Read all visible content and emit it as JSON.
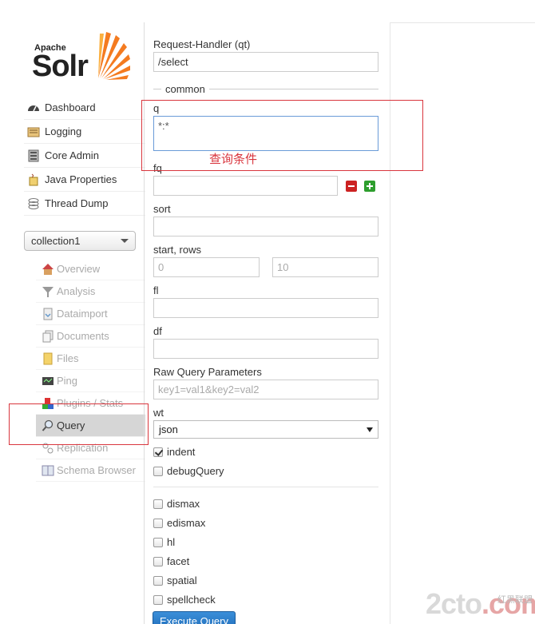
{
  "logo": {
    "line1": "Apache",
    "line2": "Solr"
  },
  "main_nav": [
    {
      "label": "Dashboard",
      "icon": "dashboard-icon"
    },
    {
      "label": "Logging",
      "icon": "logging-icon"
    },
    {
      "label": "Core Admin",
      "icon": "core-admin-icon"
    },
    {
      "label": "Java Properties",
      "icon": "java-properties-icon"
    },
    {
      "label": "Thread Dump",
      "icon": "thread-dump-icon"
    }
  ],
  "core_selector": {
    "value": "collection1"
  },
  "core_nav": [
    {
      "label": "Overview",
      "icon": "home-icon"
    },
    {
      "label": "Analysis",
      "icon": "funnel-icon"
    },
    {
      "label": "Dataimport",
      "icon": "dataimport-icon"
    },
    {
      "label": "Documents",
      "icon": "documents-icon"
    },
    {
      "label": "Files",
      "icon": "folder-icon"
    },
    {
      "label": "Ping",
      "icon": "ping-icon"
    },
    {
      "label": "Plugins / Stats",
      "icon": "plugins-icon"
    },
    {
      "label": "Query",
      "icon": "magnifier-icon"
    },
    {
      "label": "Replication",
      "icon": "replication-icon"
    },
    {
      "label": "Schema Browser",
      "icon": "schema-icon"
    }
  ],
  "form": {
    "request_handler_label": "Request-Handler (qt)",
    "request_handler_value": "/select",
    "common_legend": "common",
    "q_label": "q",
    "q_value": "*:*",
    "fq_label": "fq",
    "fq_value": "",
    "sort_label": "sort",
    "sort_value": "",
    "start_rows_label": "start, rows",
    "start_placeholder": "0",
    "rows_placeholder": "10",
    "fl_label": "fl",
    "fl_value": "",
    "df_label": "df",
    "df_value": "",
    "raw_label": "Raw Query Parameters",
    "raw_placeholder": "key1=val1&key2=val2",
    "wt_label": "wt",
    "wt_value": "json",
    "checkboxes_top": [
      {
        "label": "indent",
        "checked": true
      },
      {
        "label": "debugQuery",
        "checked": false
      }
    ],
    "checkboxes_bottom": [
      {
        "label": "dismax",
        "checked": false
      },
      {
        "label": "edismax",
        "checked": false
      },
      {
        "label": "hl",
        "checked": false
      },
      {
        "label": "facet",
        "checked": false
      },
      {
        "label": "spatial",
        "checked": false
      },
      {
        "label": "spellcheck",
        "checked": false
      }
    ],
    "execute_label": "Execute Query"
  },
  "annotation": {
    "text": "查询条件",
    "color": "#d9363e"
  },
  "watermark": {
    "main": "2cto",
    "suffix": ".com",
    "cn": "红黑联盟"
  },
  "colors": {
    "accent_blue": "#1f6bb8",
    "remove_red": "#cc2222",
    "add_green": "#2e9e2e"
  }
}
